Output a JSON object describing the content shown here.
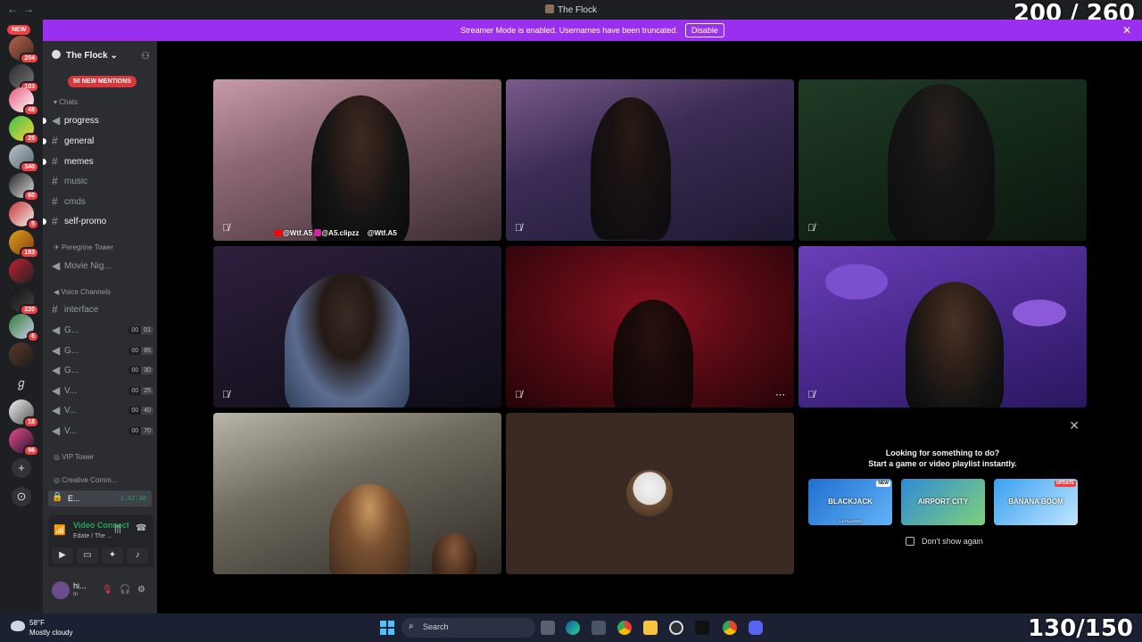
{
  "window": {
    "title": "The Flock",
    "nav_back": "←",
    "nav_forward": "→"
  },
  "overlay": {
    "top_counter": "200 / 260",
    "bottom_counter": "130/150"
  },
  "banner": {
    "text": "Streamer Mode is enabled. Usernames have been truncated.",
    "button": "Disable",
    "close": "✕"
  },
  "rail": {
    "new_label": "NEW",
    "badges": [
      "204",
      "103",
      "48",
      "25",
      "340",
      "60",
      "5",
      "183",
      "220",
      "6",
      "18",
      "96"
    ],
    "add_server": "+",
    "discover": "⊙"
  },
  "server": {
    "name": "The Flock",
    "chevron": "⌄",
    "mentions": "50 NEW MENTIONS",
    "categories": {
      "chats": "Chats",
      "peregrine": "Peregrine Tower",
      "voice": "Voice Channels",
      "vip": "VIP Tower",
      "creative": "Creative Comm..."
    },
    "text_channels": [
      {
        "name": "progress",
        "unread": true
      },
      {
        "name": "general",
        "unread": true
      },
      {
        "name": "memes",
        "unread": true
      },
      {
        "name": "music",
        "unread": false
      },
      {
        "name": "cmds",
        "unread": false
      },
      {
        "name": "self-promo",
        "unread": true
      }
    ],
    "movie_channel": "Movie Nig...",
    "interface_channel": "interface",
    "voice_channels": [
      {
        "name": "G...",
        "count": "00",
        "limit": "01"
      },
      {
        "name": "G...",
        "count": "00",
        "limit": "85"
      },
      {
        "name": "G...",
        "count": "00",
        "limit": "30"
      },
      {
        "name": "V...",
        "count": "00",
        "limit": "25"
      },
      {
        "name": "V...",
        "count": "00",
        "limit": "40"
      },
      {
        "name": "V...",
        "count": "00",
        "limit": "70"
      }
    ],
    "active_channel": {
      "name": "E...",
      "time": "1:42:30"
    }
  },
  "voice_panel": {
    "title": "Video Connected",
    "subtitle": "Edate / The ..."
  },
  "user_panel": {
    "name": "hi...",
    "status": "In"
  },
  "video_tiles": [
    {
      "socials": [
        "@Wtf.A5",
        "@A5.clipzz",
        "@Wtf.A5"
      ]
    }
  ],
  "activity": {
    "close": "✕",
    "heading": "Looking for something to do?",
    "subheading": "Start a game or video playlist instantly.",
    "cards": [
      {
        "name": "BLACKJACK",
        "tag": "NEW",
        "sub": "2-8 PLAYERS",
        "color1": "#1f6fd1",
        "color2": "#63b3f7"
      },
      {
        "name": "AIRPORT CITY",
        "tag": "",
        "sub": "",
        "color1": "#2e8bd6",
        "color2": "#7fd07a"
      },
      {
        "name": "BANANA BOOM",
        "tag": "UPDATE",
        "sub": "",
        "color1": "#3aa0f0",
        "color2": "#bfe6ff"
      }
    ],
    "dont_show": "Don't show again"
  },
  "taskbar": {
    "temperature": "58°F",
    "condition": "Mostly cloudy",
    "search_placeholder": "Search"
  },
  "colors": {
    "banner": "#9b2ff0",
    "online_green": "#23a55a",
    "danger_red": "#f23f43"
  }
}
